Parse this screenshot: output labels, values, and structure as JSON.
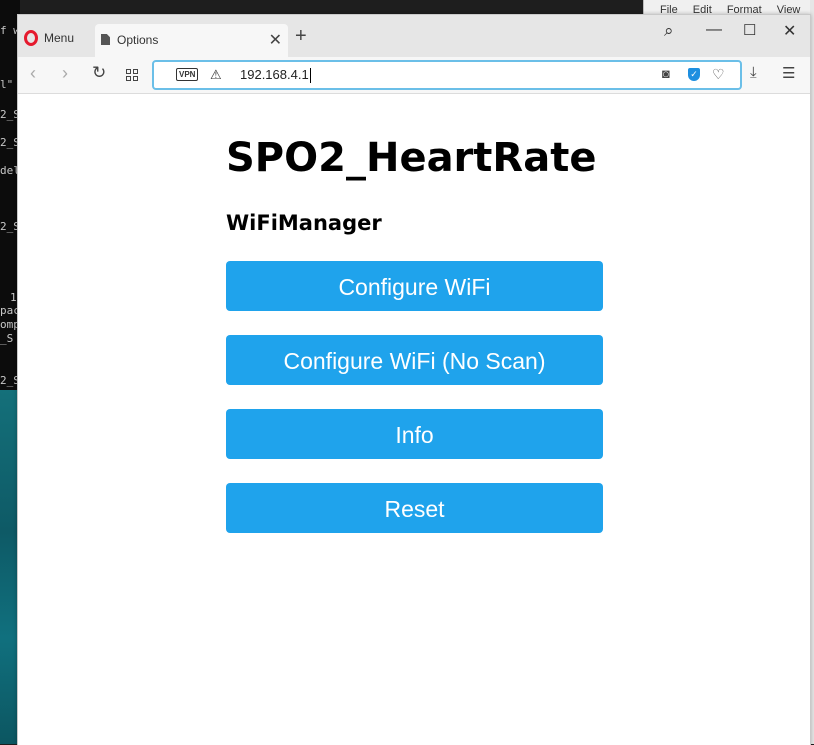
{
  "background": {
    "terminal_lines": [
      "f w",
      "l\"",
      "2_S",
      "2_S",
      "del",
      "2_S",
      "1",
      "pac",
      "omp",
      "_S",
      "2_S"
    ],
    "notepad_menu": [
      "File",
      "Edit",
      "Format",
      "View"
    ]
  },
  "browser": {
    "menu_label": "Menu",
    "tab_title": "Options",
    "address": "192.168.4.1",
    "vpn_badge": "VPN"
  },
  "page": {
    "title": "SPO2_HeartRate",
    "subtitle": "WiFiManager",
    "buttons": [
      "Configure WiFi",
      "Configure WiFi (No Scan)",
      "Info",
      "Reset"
    ],
    "button_color": "#1fa3ec"
  }
}
